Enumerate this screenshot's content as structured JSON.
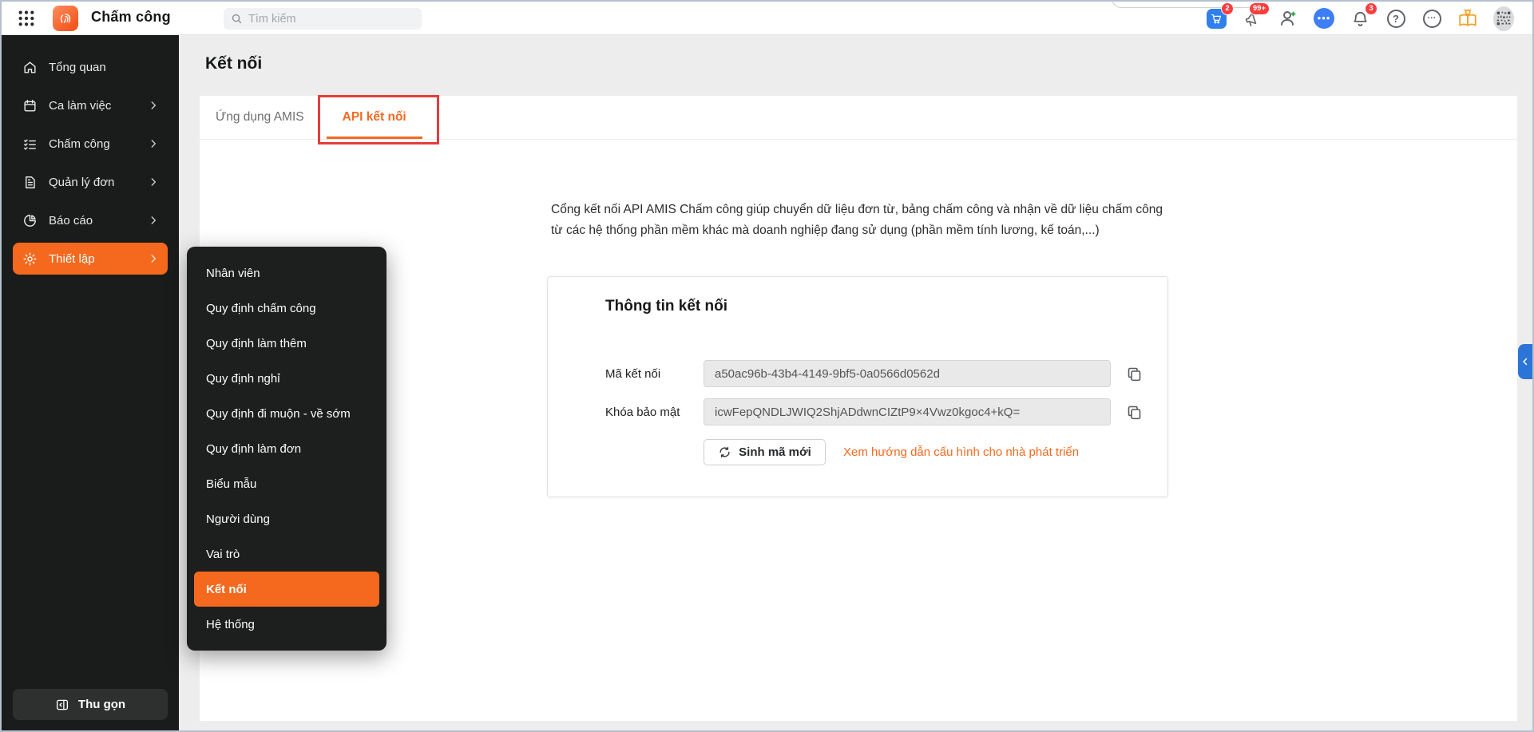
{
  "topbar": {
    "app_title": "Chấm công",
    "search_placeholder": "Tìm kiếm",
    "cart_badge": "2",
    "megaphone_badge": "99+",
    "bell_badge": "3",
    "help_glyph": "?",
    "more_glyph": "...",
    "chat_glyph": "•••"
  },
  "sidebar": {
    "items": [
      {
        "label": "Tổng quan"
      },
      {
        "label": "Ca làm việc"
      },
      {
        "label": "Chấm công"
      },
      {
        "label": "Quản lý đơn"
      },
      {
        "label": "Báo cáo"
      },
      {
        "label": "Thiết lập"
      }
    ],
    "collapse_label": "Thu gọn"
  },
  "flyout": {
    "items": [
      {
        "label": "Nhân viên"
      },
      {
        "label": "Quy định chấm công"
      },
      {
        "label": "Quy định làm thêm"
      },
      {
        "label": "Quy định nghỉ"
      },
      {
        "label": "Quy định đi muộn - về sớm"
      },
      {
        "label": "Quy định làm đơn"
      },
      {
        "label": "Biểu mẫu"
      },
      {
        "label": "Người dùng"
      },
      {
        "label": "Vai trò"
      },
      {
        "label": "Kết nối"
      },
      {
        "label": "Hệ thống"
      }
    ]
  },
  "main": {
    "page_title": "Kết nối",
    "tabs": [
      {
        "label": "Ứng dụng AMIS"
      },
      {
        "label": "API kết nối"
      }
    ],
    "description": "Cổng kết nối API AMIS Chấm công giúp chuyển dữ liệu đơn từ, bảng chấm công và nhận về dữ liệu chấm công từ các hệ thống phần mềm khác mà doanh nghiệp đang sử dụng (phần mềm tính lương, kế toán,...)",
    "card": {
      "title": "Thông tin kết nối",
      "fields": [
        {
          "label": "Mã kết nối",
          "value": "a50ac96b-43b4-4149-9bf5-0a0566d0562d"
        },
        {
          "label": "Khóa bảo mật",
          "value": "icwFepQNDLJWIQ2ShjADdwnCIZtP9×4Vwz0kgoc4+kQ="
        }
      ],
      "regenerate_label": "Sinh mã mới",
      "guide_link": "Xem hướng dẫn cấu hình cho nhà phát triển"
    }
  },
  "colors": {
    "accent_orange": "#f4691e",
    "sidebar_bg": "#1a1c1b",
    "annotation_red": "#e43d3a",
    "flap_blue": "#2b75d8",
    "badge_red": "#fa3e3e",
    "cart_blue": "#2f80ed",
    "chat_blue": "#3d7ef7",
    "lamp_orange": "#f2a32d"
  }
}
